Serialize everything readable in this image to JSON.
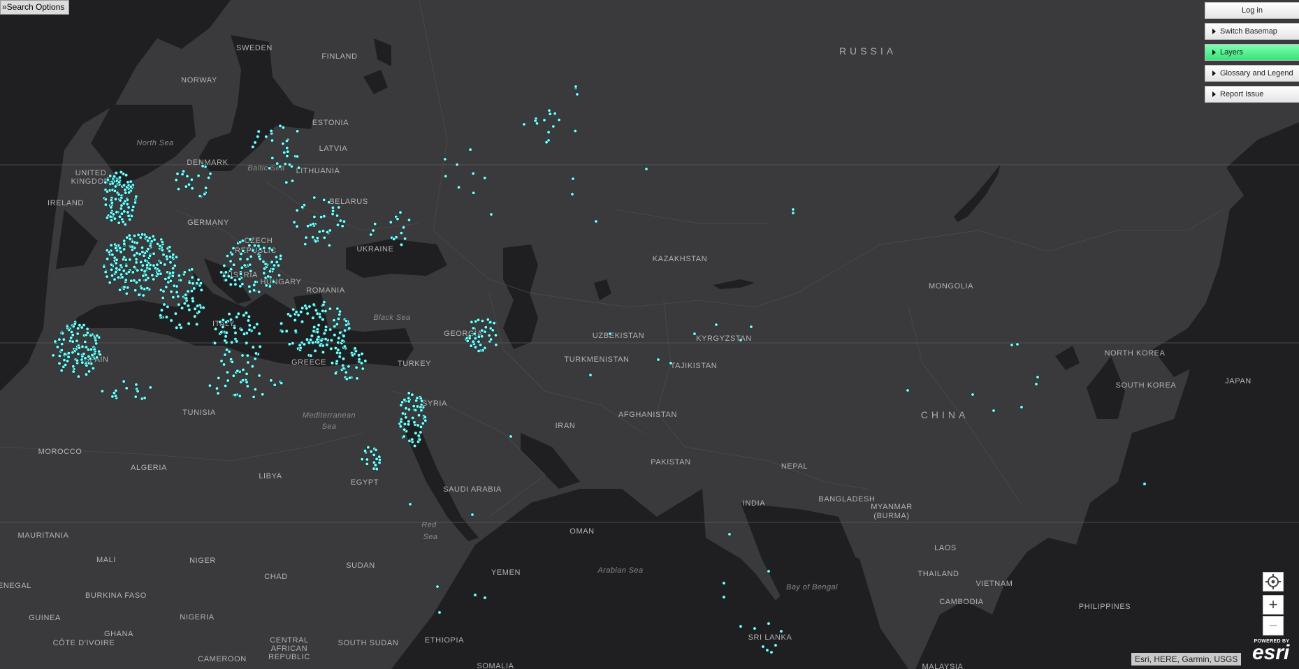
{
  "search_options_label": "»Search Options",
  "panel": {
    "login": "Log in",
    "switch_basemap": "Switch Basemap",
    "layers": "Layers",
    "glossary": "Glossary and Legend",
    "report": "Report Issue"
  },
  "attribution": "Esri, HERE, Garmin, USGS",
  "esri_logo": {
    "powered": "POWERED BY",
    "name": "esri"
  },
  "colors": {
    "land": "#3a3a3c",
    "water": "#1f1f21",
    "marker": "#7fffff",
    "active_button": "#3ae27a"
  },
  "icons": {
    "locate": "locate-crosshair-icon",
    "zoom_in": "plus-icon",
    "zoom_out": "minus-icon"
  },
  "map_labels": {
    "countries": {
      "sweden": "SWEDEN",
      "finland": "FINLAND",
      "russia": "RUSSIA",
      "norway": "NORWAY",
      "estonia": "ESTONIA",
      "latvia": "LATVIA",
      "denmark": "DENMARK",
      "lithuania": "LITHUANIA",
      "united_kingdom_1": "UNITED",
      "united_kingdom_2": "KINGDOM",
      "ireland": "IRELAND",
      "belarus": "BELARUS",
      "germany": "GERMANY",
      "czech_1": "CZECH",
      "czech_2": "REPUBLIC",
      "ukraine": "UKRAINE",
      "austria": "AUSTRIA",
      "hungary": "HUNGARY",
      "romania": "ROMANIA",
      "kazakhstan": "KAZAKHSTAN",
      "mongolia": "MONGOLIA",
      "italy": "ITALY",
      "georgia": "GEORGIA",
      "uzbekistan": "UZBEKISTAN",
      "kyrgyzstan": "KYRGYZSTAN",
      "spain": "SPAIN",
      "greece": "GREECE",
      "turkey": "TURKEY",
      "turkmenistan": "TURKMENISTAN",
      "tajikistan": "TAJIKISTAN",
      "north_korea": "NORTH KOREA",
      "south_korea": "SOUTH KOREA",
      "japan": "JAPAN",
      "china": "CHINA",
      "tunisia": "TUNISIA",
      "syria": "SYRIA",
      "afghanistan": "AFGHANISTAN",
      "iran": "IRAN",
      "morocco": "MOROCCO",
      "pakistan": "PAKISTAN",
      "algeria": "ALGERIA",
      "libya": "LIBYA",
      "egypt": "EGYPT",
      "nepal": "NEPAL",
      "saudi_arabia": "SAUDI ARABIA",
      "bangladesh": "BANGLADESH",
      "myanmar_1": "MYANMAR",
      "myanmar_2": "(BURMA)",
      "india": "INDIA",
      "mauritania": "MAURITANIA",
      "oman": "OMAN",
      "laos": "LAOS",
      "mali": "MALI",
      "niger": "NIGER",
      "sudan": "SUDAN",
      "chad": "CHAD",
      "yemen": "YEMEN",
      "thailand": "THAILAND",
      "vietnam": "VIETNAM",
      "senegal": "ENEGAL",
      "burkina_faso": "BURKINA FASO",
      "nigeria": "NIGERIA",
      "cambodia": "CAMBODIA",
      "philippines": "PHILIPPINES",
      "guinea": "GUINEA",
      "ghana": "GHANA",
      "ethiopia": "ETHIOPIA",
      "sri_lanka": "SRI LANKA",
      "cote_divoire": "CÔTE D'IVOIRE",
      "car_1": "CENTRAL",
      "car_2": "AFRICAN",
      "car_3": "REPUBLIC",
      "south_sudan": "SOUTH SUDAN",
      "cameroon": "CAMEROON",
      "somalia": "SOMALIA",
      "malaysia": "MALAYSIA"
    },
    "seas": {
      "north_sea": "North Sea",
      "baltic_sea": "Baltic Sea",
      "black_sea": "Black Sea",
      "mediterranean_1": "Mediterranean",
      "mediterranean_2": "Sea",
      "red_sea_1": "Red",
      "red_sea_2": "Sea",
      "arabian_sea": "Arabian Sea",
      "bay_of_bengal": "Bay of Bengal"
    }
  }
}
